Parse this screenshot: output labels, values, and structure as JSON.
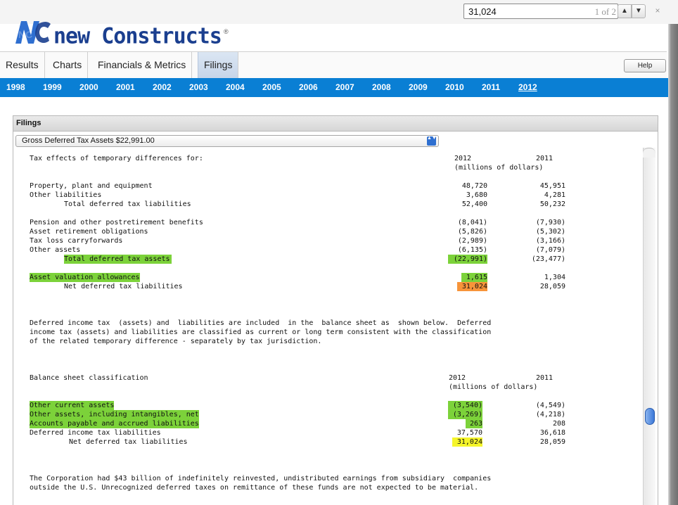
{
  "find": {
    "query": "31,024",
    "count": "1 of 2",
    "up_glyph": "▲",
    "down_glyph": "▼",
    "close_glyph": "×"
  },
  "logo": {
    "text": "new Constructs",
    "mark": "NC",
    "reg": "®"
  },
  "tabs": [
    "Results",
    "Charts",
    "Financials & Metrics",
    "Filings"
  ],
  "active_tab": "Filings",
  "help_label": "Help",
  "years": [
    "1998",
    "1999",
    "2000",
    "2001",
    "2002",
    "2003",
    "2004",
    "2005",
    "2006",
    "2007",
    "2008",
    "2009",
    "2010",
    "2011",
    "2012"
  ],
  "current_year": "2012",
  "panel": {
    "title": "Filings",
    "select_value": "Gross Deferred Tax Assets $22,991.00",
    "select_arrows": "▲▼"
  },
  "doc": {
    "t1": {
      "heading": "Tax effects of temporary differences for:",
      "col1": "2012",
      "col2": "2011",
      "units": "(millions of dollars)",
      "rows": [
        {
          "label": "Property, plant and equipment",
          "v1": "48,720",
          "v2": "45,951"
        },
        {
          "label": "Other liabilities",
          "v1": "3,680",
          "v2": "4,281"
        },
        {
          "label": "Total deferred tax liabilities",
          "v1": "52,400",
          "v2": "50,232"
        },
        {
          "label": "Pension and other postretirement benefits",
          "v1": "(8,041)",
          "v2": "(7,930)"
        },
        {
          "label": "Asset retirement obligations",
          "v1": "(5,826)",
          "v2": "(5,302)"
        },
        {
          "label": "Tax loss carryforwards",
          "v1": "(2,989)",
          "v2": "(3,166)"
        },
        {
          "label": "Other assets",
          "v1": "(6,135)",
          "v2": "(7,079)"
        },
        {
          "label": "Total deferred tax assets",
          "v1": "(22,991)",
          "v2": "(23,477)"
        },
        {
          "label": "Asset valuation allowances",
          "v1": "1,615",
          "v2": "1,304"
        },
        {
          "label": "Net deferred tax liabilities",
          "v1": "31,024",
          "v2": "28,059"
        }
      ]
    },
    "para1": [
      "Deferred income tax  (assets) and  liabilities are included  in the  balance sheet as  shown below.  Deferred",
      "income tax (assets) and liabilities are classified as current or long term consistent with the classification",
      "of the related temporary difference - separately by tax jurisdiction."
    ],
    "t2": {
      "heading": "Balance sheet classification",
      "col1": "2012",
      "col2": "2011",
      "units": "(millions of dollars)",
      "rows": [
        {
          "label": "Other current assets",
          "v1": "(3,540)",
          "v2": "(4,549)"
        },
        {
          "label": "Other assets, including intangibles, net",
          "v1": "(3,269)",
          "v2": "(4,218)"
        },
        {
          "label": "Accounts payable and accrued liabilities",
          "v1": "263",
          "v2": "208"
        },
        {
          "label": "Deferred income tax liabilities",
          "v1": "37,570",
          "v2": "36,618"
        },
        {
          "label": "Net deferred tax liabilities",
          "v1": "31,024",
          "v2": "28,059"
        }
      ]
    },
    "para2": [
      "The Corporation had $43 billion of indefinitely reinvested, undistributed earnings from subsidiary  companies",
      "outside the U.S. Unrecognized deferred taxes on remittance of these funds are not expected to be material."
    ]
  },
  "colors": {
    "year_bar": "#0a7fd4",
    "highlight_green": "#7cd23a",
    "highlight_orange": "#f7943a",
    "highlight_yellow": "#f5f52a",
    "logo_blue": "#1b3f8f"
  }
}
